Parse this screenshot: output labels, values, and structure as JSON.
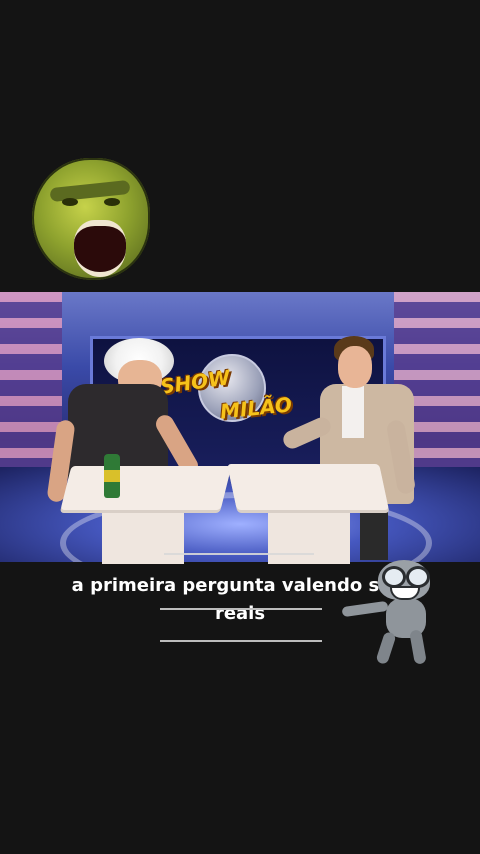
{
  "video": {
    "show_logo": {
      "word_top": "SHOW",
      "word_bottom": "MILÃO"
    }
  },
  "caption": {
    "line1": "a primeira pergunta valendo seis",
    "line2": "reais"
  },
  "stickers": {
    "top": "screaming-green-face-icon",
    "bottom": "dancing-frog-icon"
  }
}
